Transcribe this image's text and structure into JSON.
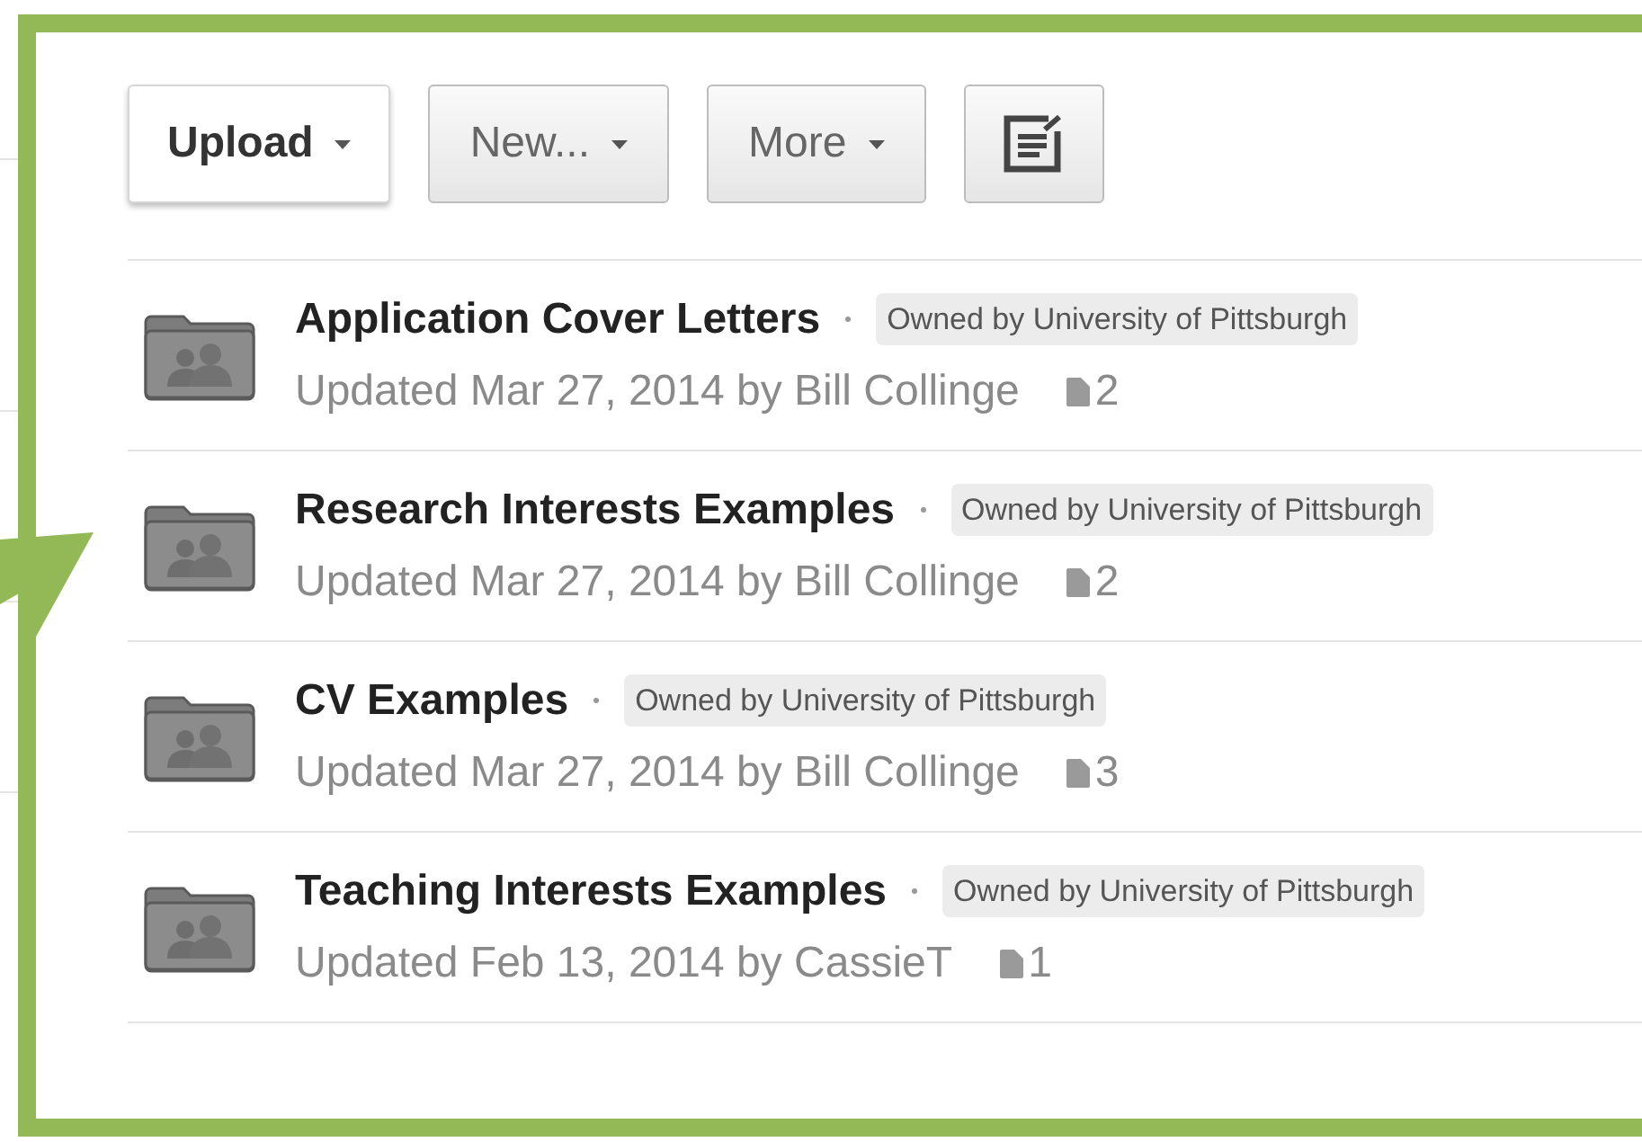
{
  "toolbar": [
    {
      "kind": "primary",
      "label": "Upload",
      "dropdown": true
    },
    {
      "kind": "default",
      "label": "New...",
      "dropdown": true
    },
    {
      "kind": "default",
      "label": "More",
      "dropdown": true
    },
    {
      "kind": "icon",
      "dropdown": false
    }
  ],
  "folders": [
    {
      "title": "Application Cover Letters",
      "owner": "Owned by University of Pittsburgh",
      "updated": "Updated Mar 27, 2014 by Bill Collinge",
      "count": "2"
    },
    {
      "title": "Research Interests Examples",
      "owner": "Owned by University of Pittsburgh",
      "updated": "Updated Mar 27, 2014 by Bill Collinge",
      "count": "2"
    },
    {
      "title": "CV Examples",
      "owner": "Owned by University of Pittsburgh",
      "updated": "Updated Mar 27, 2014 by Bill Collinge",
      "count": "3"
    },
    {
      "title": "Teaching Interests Examples",
      "owner": "Owned by University of Pittsburgh",
      "updated": "Updated Feb 13, 2014 by CassieT",
      "count": "1"
    }
  ]
}
